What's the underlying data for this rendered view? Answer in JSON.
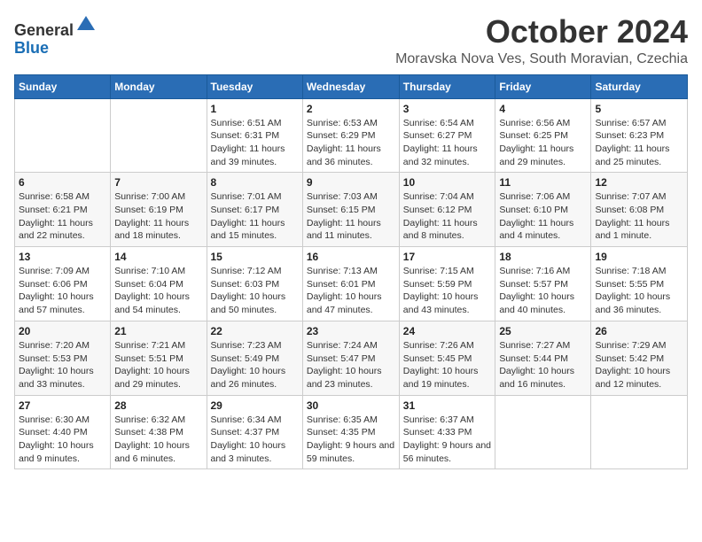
{
  "header": {
    "logo_line1": "General",
    "logo_line2": "Blue",
    "month": "October 2024",
    "location": "Moravska Nova Ves, South Moravian, Czechia"
  },
  "weekdays": [
    "Sunday",
    "Monday",
    "Tuesday",
    "Wednesday",
    "Thursday",
    "Friday",
    "Saturday"
  ],
  "weeks": [
    [
      {
        "day": "",
        "info": ""
      },
      {
        "day": "",
        "info": ""
      },
      {
        "day": "1",
        "info": "Sunrise: 6:51 AM\nSunset: 6:31 PM\nDaylight: 11 hours and 39 minutes."
      },
      {
        "day": "2",
        "info": "Sunrise: 6:53 AM\nSunset: 6:29 PM\nDaylight: 11 hours and 36 minutes."
      },
      {
        "day": "3",
        "info": "Sunrise: 6:54 AM\nSunset: 6:27 PM\nDaylight: 11 hours and 32 minutes."
      },
      {
        "day": "4",
        "info": "Sunrise: 6:56 AM\nSunset: 6:25 PM\nDaylight: 11 hours and 29 minutes."
      },
      {
        "day": "5",
        "info": "Sunrise: 6:57 AM\nSunset: 6:23 PM\nDaylight: 11 hours and 25 minutes."
      }
    ],
    [
      {
        "day": "6",
        "info": "Sunrise: 6:58 AM\nSunset: 6:21 PM\nDaylight: 11 hours and 22 minutes."
      },
      {
        "day": "7",
        "info": "Sunrise: 7:00 AM\nSunset: 6:19 PM\nDaylight: 11 hours and 18 minutes."
      },
      {
        "day": "8",
        "info": "Sunrise: 7:01 AM\nSunset: 6:17 PM\nDaylight: 11 hours and 15 minutes."
      },
      {
        "day": "9",
        "info": "Sunrise: 7:03 AM\nSunset: 6:15 PM\nDaylight: 11 hours and 11 minutes."
      },
      {
        "day": "10",
        "info": "Sunrise: 7:04 AM\nSunset: 6:12 PM\nDaylight: 11 hours and 8 minutes."
      },
      {
        "day": "11",
        "info": "Sunrise: 7:06 AM\nSunset: 6:10 PM\nDaylight: 11 hours and 4 minutes."
      },
      {
        "day": "12",
        "info": "Sunrise: 7:07 AM\nSunset: 6:08 PM\nDaylight: 11 hours and 1 minute."
      }
    ],
    [
      {
        "day": "13",
        "info": "Sunrise: 7:09 AM\nSunset: 6:06 PM\nDaylight: 10 hours and 57 minutes."
      },
      {
        "day": "14",
        "info": "Sunrise: 7:10 AM\nSunset: 6:04 PM\nDaylight: 10 hours and 54 minutes."
      },
      {
        "day": "15",
        "info": "Sunrise: 7:12 AM\nSunset: 6:03 PM\nDaylight: 10 hours and 50 minutes."
      },
      {
        "day": "16",
        "info": "Sunrise: 7:13 AM\nSunset: 6:01 PM\nDaylight: 10 hours and 47 minutes."
      },
      {
        "day": "17",
        "info": "Sunrise: 7:15 AM\nSunset: 5:59 PM\nDaylight: 10 hours and 43 minutes."
      },
      {
        "day": "18",
        "info": "Sunrise: 7:16 AM\nSunset: 5:57 PM\nDaylight: 10 hours and 40 minutes."
      },
      {
        "day": "19",
        "info": "Sunrise: 7:18 AM\nSunset: 5:55 PM\nDaylight: 10 hours and 36 minutes."
      }
    ],
    [
      {
        "day": "20",
        "info": "Sunrise: 7:20 AM\nSunset: 5:53 PM\nDaylight: 10 hours and 33 minutes."
      },
      {
        "day": "21",
        "info": "Sunrise: 7:21 AM\nSunset: 5:51 PM\nDaylight: 10 hours and 29 minutes."
      },
      {
        "day": "22",
        "info": "Sunrise: 7:23 AM\nSunset: 5:49 PM\nDaylight: 10 hours and 26 minutes."
      },
      {
        "day": "23",
        "info": "Sunrise: 7:24 AM\nSunset: 5:47 PM\nDaylight: 10 hours and 23 minutes."
      },
      {
        "day": "24",
        "info": "Sunrise: 7:26 AM\nSunset: 5:45 PM\nDaylight: 10 hours and 19 minutes."
      },
      {
        "day": "25",
        "info": "Sunrise: 7:27 AM\nSunset: 5:44 PM\nDaylight: 10 hours and 16 minutes."
      },
      {
        "day": "26",
        "info": "Sunrise: 7:29 AM\nSunset: 5:42 PM\nDaylight: 10 hours and 12 minutes."
      }
    ],
    [
      {
        "day": "27",
        "info": "Sunrise: 6:30 AM\nSunset: 4:40 PM\nDaylight: 10 hours and 9 minutes."
      },
      {
        "day": "28",
        "info": "Sunrise: 6:32 AM\nSunset: 4:38 PM\nDaylight: 10 hours and 6 minutes."
      },
      {
        "day": "29",
        "info": "Sunrise: 6:34 AM\nSunset: 4:37 PM\nDaylight: 10 hours and 3 minutes."
      },
      {
        "day": "30",
        "info": "Sunrise: 6:35 AM\nSunset: 4:35 PM\nDaylight: 9 hours and 59 minutes."
      },
      {
        "day": "31",
        "info": "Sunrise: 6:37 AM\nSunset: 4:33 PM\nDaylight: 9 hours and 56 minutes."
      },
      {
        "day": "",
        "info": ""
      },
      {
        "day": "",
        "info": ""
      }
    ]
  ]
}
